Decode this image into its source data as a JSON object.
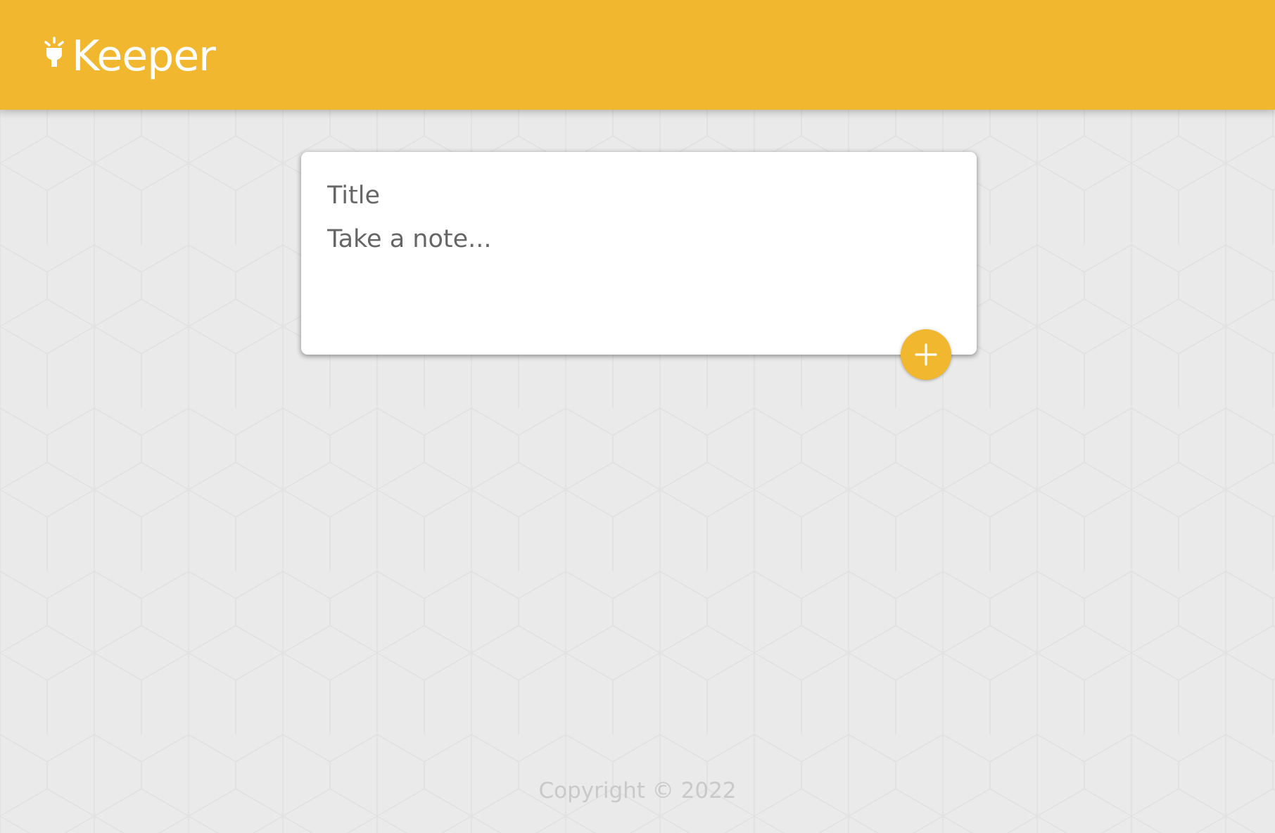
{
  "app": {
    "name": "Keeper",
    "logo_icon": "lightbulb-icon"
  },
  "colors": {
    "brand": "#f1b72e",
    "background": "#eaeaea",
    "card": "#ffffff",
    "placeholder_text": "#666666",
    "footer_text": "#c9c9c9"
  },
  "note_form": {
    "title_placeholder": "Title",
    "title_value": "",
    "content_placeholder": "Take a note...",
    "content_value": "",
    "add_button_icon": "plus-icon"
  },
  "footer": {
    "copyright": "Copyright © 2022"
  }
}
